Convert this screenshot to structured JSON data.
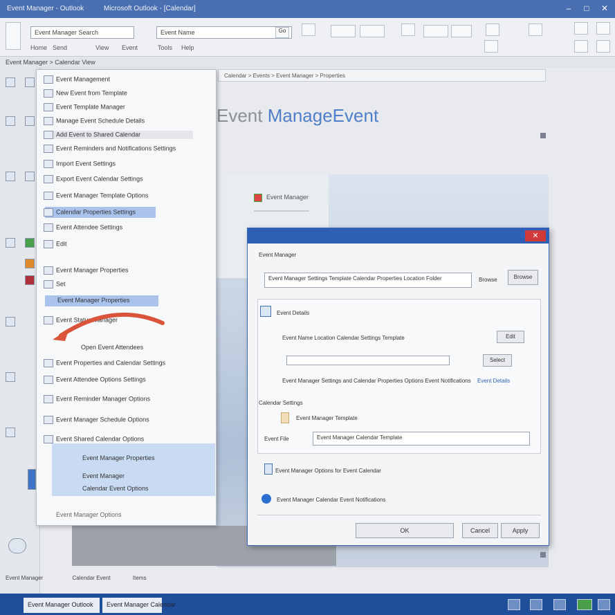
{
  "window": {
    "app_title": "Event Manager - Outlook",
    "doc_title": "Microsoft Outlook - [Calendar]",
    "controls": [
      "–",
      "□",
      "✕"
    ]
  },
  "ribbon": {
    "search_value": "Event Manager Search",
    "find_value": "Event Name",
    "find_button": "Go",
    "labels": [
      "Home",
      "Send",
      "View",
      "Event",
      "Tools",
      "Help"
    ]
  },
  "subheader": "Event Manager > Calendar View",
  "breadcrumb": "Calendar > Events > Event Manager > Properties",
  "heading": {
    "prefix": "Event ",
    "highlight": "ManageEvent"
  },
  "preview": {
    "card_title": "Event Manager"
  },
  "context_menu": {
    "items": [
      "Event Management",
      "New Event from Template",
      "Event Template Manager",
      "Manage Event Schedule Details",
      "Add Event to Shared Calendar",
      "Event Reminders and Notifications Settings",
      "Import Event Settings",
      "Export Event Calendar Settings",
      "Event Manager Template Options",
      "Calendar Properties Settings",
      "Event Attendee Settings",
      "Edit",
      "Event Manager Properties",
      "Set",
      "Event Status Manager",
      "Open Event Attendees",
      "Event Properties and Calendar Settings",
      "Event Attendee Options Settings",
      "Event Reminder Manager Options",
      "Event Manager Schedule Options",
      "Event Shared Calendar Options",
      "Event Manager Properties",
      "Event Manager",
      "Calendar Event Options"
    ],
    "highlight_item": "Event Manager Properties",
    "footer": "Event Manager Options"
  },
  "dialog": {
    "heading": "Event Manager",
    "path_label": "Event Manager Settings Template Calendar Properties Location Folder",
    "browse_button": "Browse",
    "section1_title": "Event Details",
    "field1_label": "Event Name Location Calendar Settings Template",
    "field1_btn": "Edit",
    "field2_btn": "Select",
    "note_text": "Event Manager Settings and Calendar Properties Options Event Notifications",
    "note_link": "Event Details",
    "section2_title": "Calendar Settings",
    "attach_label": "Event Manager Template",
    "file_label": "Event File",
    "file_value": "Event Manager Calendar Template",
    "option1": "Event Manager Options for Event Calendar",
    "option2": "Event Manager Calendar Event Notifications",
    "ok_button": "OK",
    "cancel_button": "Cancel",
    "apply_button": "Apply"
  },
  "statusbar": {
    "left": "Event Manager",
    "mid": "Calendar Event",
    "right": "Items"
  },
  "taskbar": {
    "item1": "Event Manager Outlook",
    "item2": "Event Manager Calendar"
  },
  "colors": {
    "accent": "#2d5fb5",
    "arrow": "#d9543a",
    "taskbar": "#1f4f9a"
  }
}
